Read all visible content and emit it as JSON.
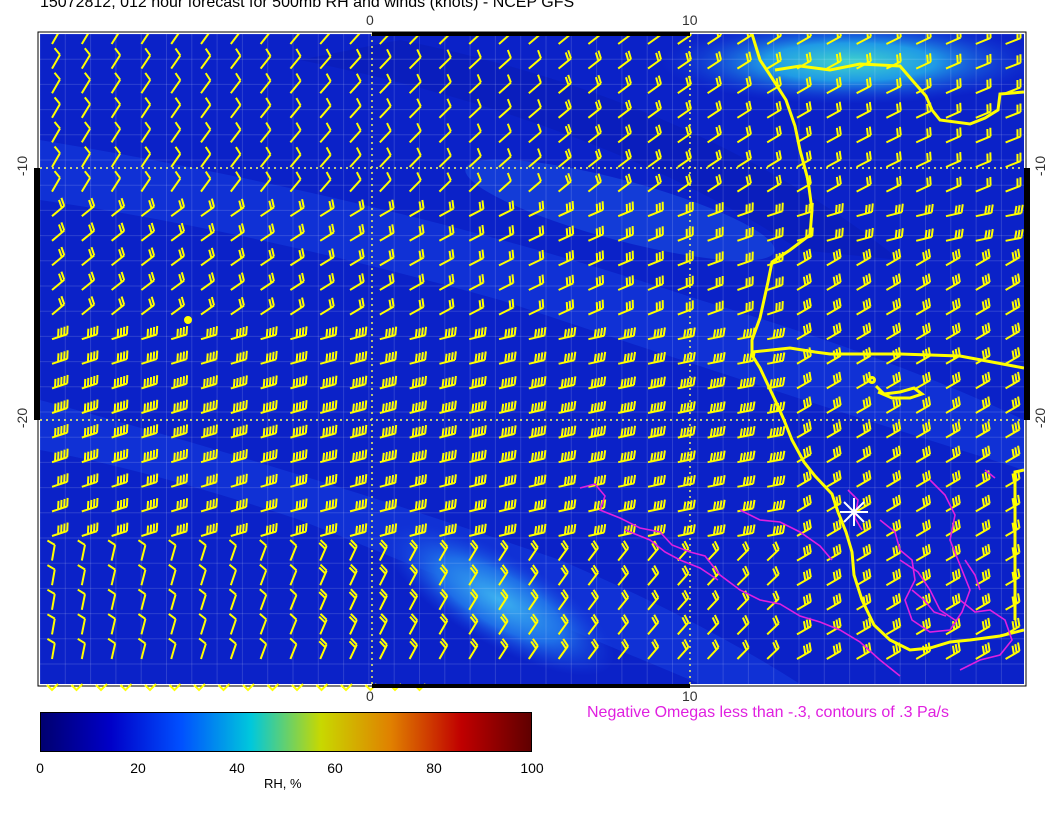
{
  "title": "15072812, 012 hour forecast for 500mb RH and winds (knots) - NCEP GFS",
  "axes": {
    "lon_ticks_top": [
      "0",
      "10"
    ],
    "lon_ticks_bottom": [
      "0",
      "10"
    ],
    "lat_ticks_left": [
      "-10",
      "-20"
    ],
    "lat_ticks_right": [
      "-10",
      "-20"
    ]
  },
  "omega_note": "Negative Omegas less than -.3, contours of .3 Pa/s",
  "colorbar": {
    "ticks": [
      "0",
      "20",
      "40",
      "60",
      "80",
      "100"
    ],
    "unit": "RH, %",
    "stops": [
      "#000070",
      "#0000c8",
      "#0050ff",
      "#00c8dc",
      "#c8d800",
      "#e08000",
      "#c00000",
      "#600000"
    ]
  },
  "colors": {
    "barbs": "#ffff00",
    "coast": "#ffff00",
    "omega": "#e020e0",
    "background_rh": "#0a2ad0"
  },
  "marker": "white-star-station-icon"
}
